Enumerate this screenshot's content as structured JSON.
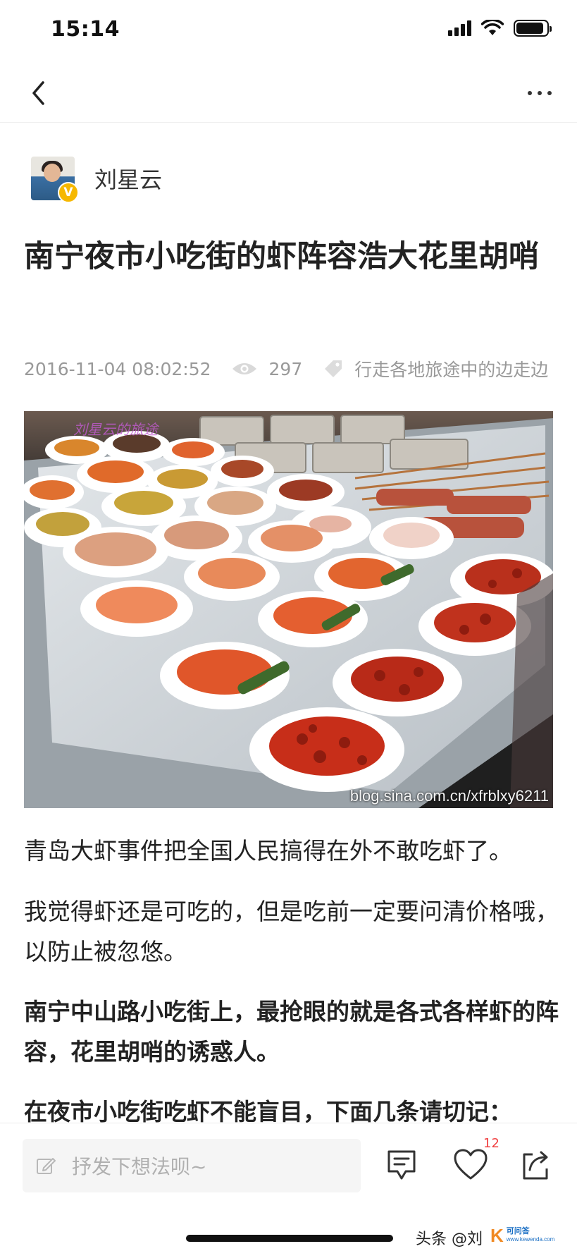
{
  "status_bar": {
    "time": "15:14",
    "signal_icon": "cellular-signal-icon",
    "wifi_icon": "wifi-icon",
    "battery_icon": "battery-icon",
    "battery_level": 0.9
  },
  "nav": {
    "back_icon": "chevron-left-icon",
    "more_icon": "more-dots-icon"
  },
  "author": {
    "name": "刘星云",
    "verified_badge": "V"
  },
  "article": {
    "title": "南宁夜市小吃街的虾阵容浩大花里胡哨",
    "date": "2016-11-04 08:02:52",
    "views": "297",
    "source": "行走各地旅途中的边走边",
    "image": {
      "subject": "seafood-night-market-photo",
      "watermark": "blog.sina.com.cn/xfrblxy6211"
    },
    "paragraphs": [
      "青岛大虾事件把全国人民搞得在外不敢吃虾了。",
      "我觉得虾还是可吃的，但是吃前一定要问清价格哦，以防止被忽悠。",
      "南宁中山路小吃街上，最抢眼的就是各式各样虾的阵容，花里胡哨的诱惑人。",
      "在夜市小吃街吃虾不能盲目，下面几条请切记："
    ]
  },
  "bottom_bar": {
    "comment_placeholder": "抒发下想法呗~",
    "like_count": "12",
    "credit_text": "头条 @刘",
    "logo_k": "K",
    "logo_name": "可问答",
    "logo_url": "www.kewenda.com"
  },
  "colors": {
    "text": "#222222",
    "meta": "#999999",
    "badge": "#f6b800",
    "like_count": "#f04142"
  }
}
